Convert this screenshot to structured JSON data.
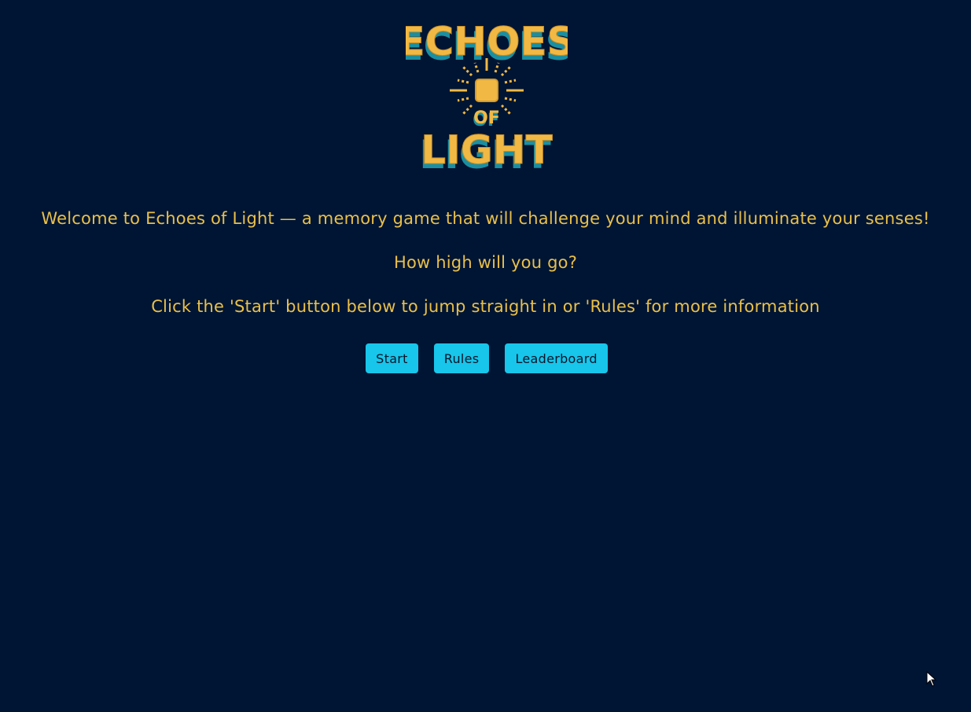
{
  "logo": {
    "line1": "ECHOES",
    "line2": "OF",
    "line3": "LIGHT"
  },
  "intro": {
    "welcome": "Welcome to Echoes of Light — a memory game that will challenge your mind and illuminate your senses!",
    "question": "How high will you go?",
    "instruction": "Click the 'Start' button below to jump straight in or 'Rules' for more information"
  },
  "buttons": {
    "start": "Start",
    "rules": "Rules",
    "leaderboard": "Leaderboard"
  },
  "colors": {
    "background": "#001433",
    "text": "#e8c04a",
    "button": "#17c6ea",
    "logo_gold": "#f1b944",
    "logo_teal": "#1b8fa1"
  },
  "icons": {
    "logo_center": "sun-icon",
    "pointer": "mouse-cursor-icon"
  }
}
